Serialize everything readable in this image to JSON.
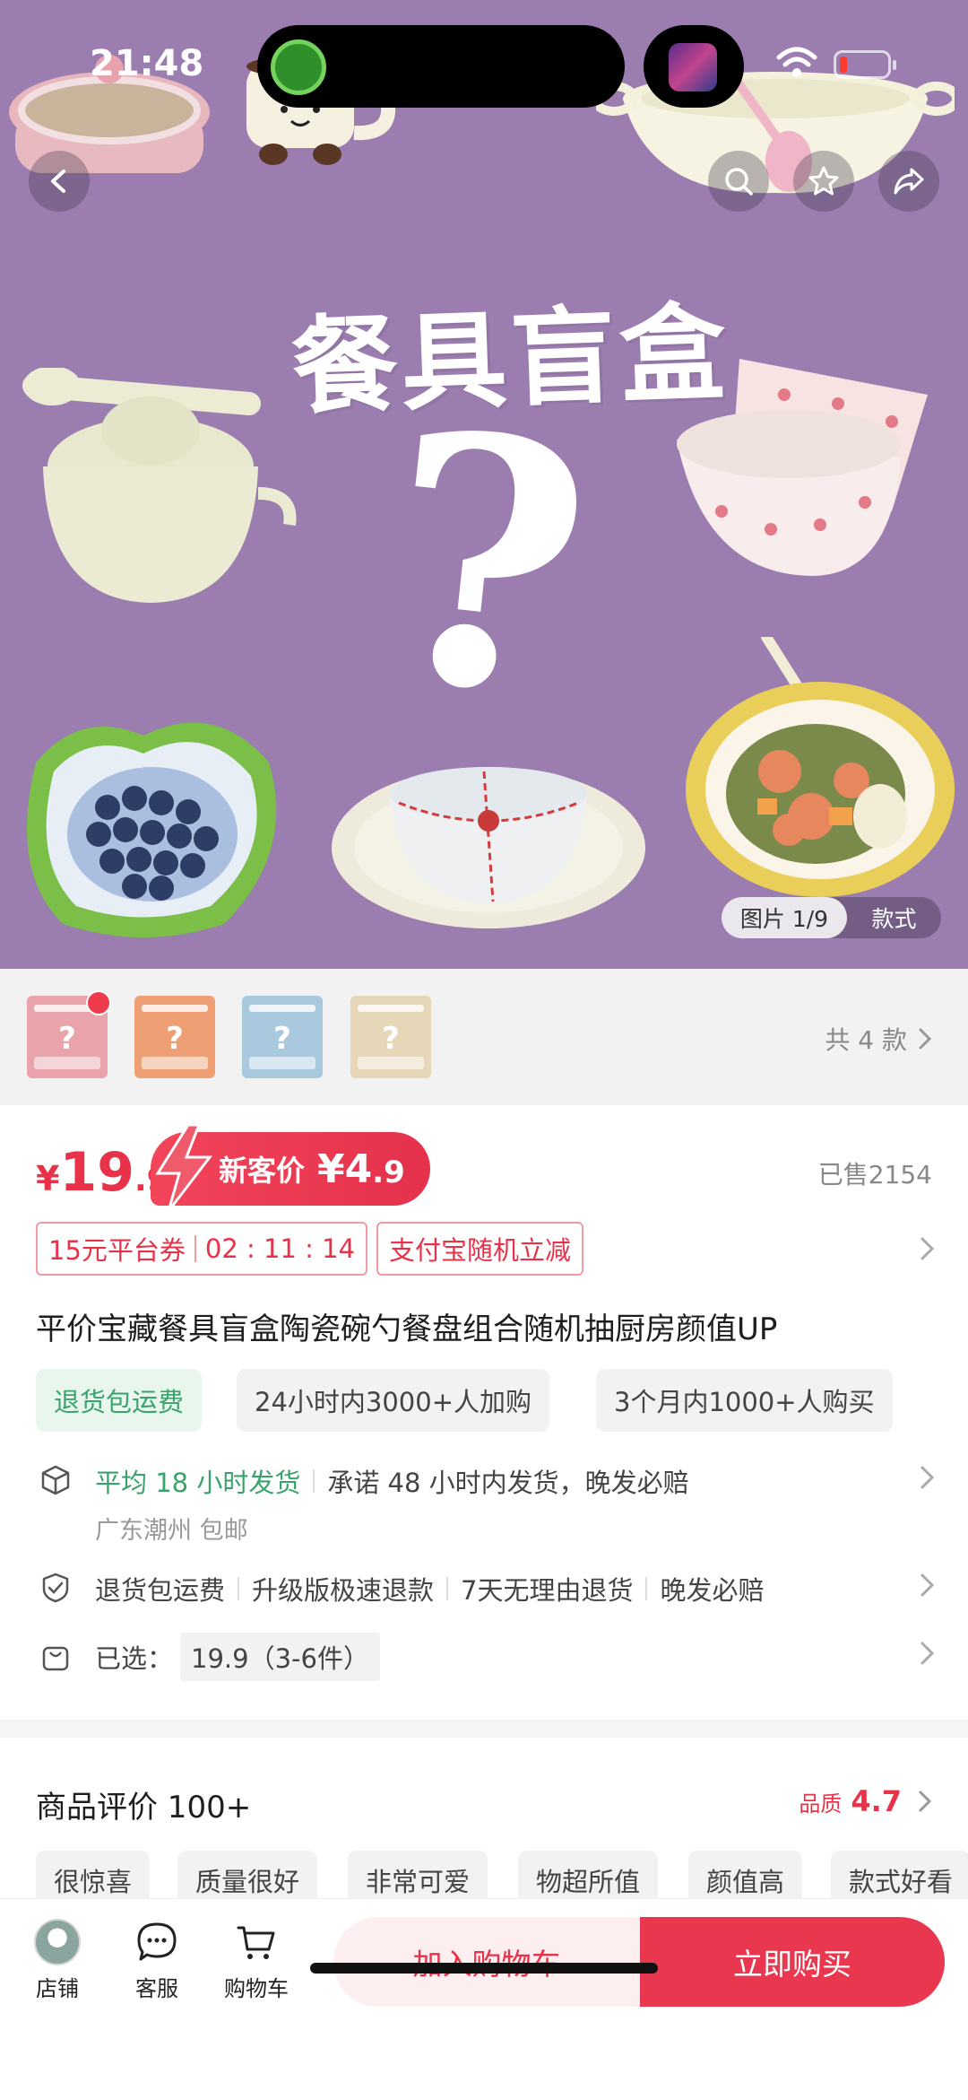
{
  "status_bar": {
    "time": "21:48"
  },
  "hero": {
    "title": "餐具盲盒",
    "question_mark": "?",
    "image_counter": "图片 1/9",
    "style_label": "款式",
    "bg_color": "#9b7db0"
  },
  "variants": {
    "count_label": "共 4 款",
    "thumbs": [
      {
        "color": "#e9a3ab",
        "mark": "?"
      },
      {
        "color": "#ee9f73",
        "mark": "?"
      },
      {
        "color": "#a9c9df",
        "mark": "?"
      },
      {
        "color": "#e6d7b8",
        "mark": "?"
      }
    ]
  },
  "price": {
    "currency": "¥",
    "integer": "19",
    "decimal": ".9",
    "new_label": "新客价",
    "new_currency": "¥",
    "new_integer": "4",
    "new_decimal": ".9",
    "sold": "已售2154"
  },
  "coupons": {
    "platform": "15元平台券",
    "countdown": "02 : 11 : 14",
    "alipay": "支付宝随机立减"
  },
  "product_title": "平价宝藏餐具盲盒陶瓷碗勺餐盘组合随机抽厨房颜值UP",
  "tags": [
    "退货包运费",
    "24小时内3000+人加购",
    "3个月内1000+人购买"
  ],
  "shipping": {
    "highlight": "平均 18 小时发货",
    "promise": "承诺 48 小时内发货，晚发必赔",
    "origin": "广东潮州 包邮"
  },
  "guarantees": [
    "退货包运费",
    "升级版极速退款",
    "7天无理由退货",
    "晚发必赔"
  ],
  "selected": {
    "label": "已选：",
    "value": "19.9（3-6件）"
  },
  "reviews": {
    "title": "商品评价 100+",
    "quality_label": "品质",
    "quality_score": "4.7",
    "tags": [
      "很惊喜",
      "质量很好",
      "非常可爱",
      "物超所值",
      "颜值高",
      "款式好看"
    ]
  },
  "bottom_bar": {
    "shop": "店铺",
    "service": "客服",
    "cart": "购物车",
    "add_to_cart": "加入购物车",
    "buy_now": "立即购买"
  }
}
